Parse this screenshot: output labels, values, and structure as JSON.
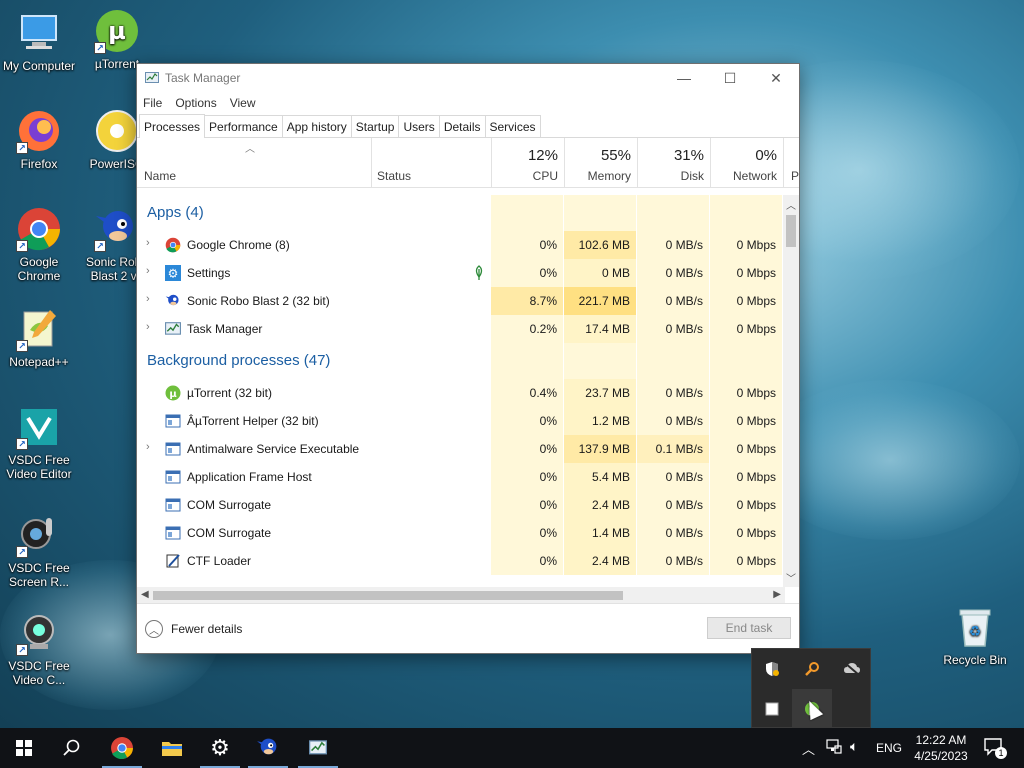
{
  "desktop": {
    "icons": [
      {
        "label": "My Computer",
        "icon": "computer-icon"
      },
      {
        "label": "µTorrent",
        "icon": "utorrent-icon"
      },
      {
        "label": "Firefox",
        "icon": "firefox-icon"
      },
      {
        "label": "PowerISO",
        "icon": "poweriso-icon"
      },
      {
        "label": "Google Chrome",
        "icon": "chrome-icon"
      },
      {
        "label": "Sonic Robo Blast 2 v2",
        "icon": "sonic-icon"
      },
      {
        "label": "Notepad++",
        "icon": "notepadpp-icon"
      },
      {
        "label": "VSDC Free Video Editor",
        "icon": "vsdc-editor-icon"
      },
      {
        "label": "VSDC Free Screen R...",
        "icon": "vsdc-screen-icon"
      },
      {
        "label": "VSDC Free Video C...",
        "icon": "vsdc-capture-icon"
      },
      {
        "label": "Recycle Bin",
        "icon": "recycle-bin-icon"
      }
    ]
  },
  "window": {
    "title": "Task Manager",
    "menu": [
      "File",
      "Options",
      "View"
    ],
    "tabs": [
      "Processes",
      "Performance",
      "App history",
      "Startup",
      "Users",
      "Details",
      "Services"
    ],
    "active_tab": "Processes",
    "columns": {
      "name": "Name",
      "status": "Status",
      "cpu": {
        "pct": "12%",
        "label": "CPU"
      },
      "memory": {
        "pct": "55%",
        "label": "Memory"
      },
      "disk": {
        "pct": "31%",
        "label": "Disk"
      },
      "network": {
        "pct": "0%",
        "label": "Network"
      },
      "power_partial": "P"
    },
    "groups": [
      {
        "title": "Apps (4)",
        "rows": [
          {
            "name": "Google Chrome (8)",
            "expandable": true,
            "icon": "chrome-icon",
            "status": "",
            "cpu": "0%",
            "memory": "102.6 MB",
            "disk": "0 MB/s",
            "network": "0 Mbps"
          },
          {
            "name": "Settings",
            "expandable": true,
            "icon": "gear-icon",
            "status": "leaf-icon",
            "cpu": "0%",
            "memory": "0 MB",
            "disk": "0 MB/s",
            "network": "0 Mbps"
          },
          {
            "name": "Sonic Robo Blast 2 (32 bit)",
            "expandable": true,
            "icon": "sonic-icon",
            "status": "",
            "cpu": "8.7%",
            "memory": "221.7 MB",
            "disk": "0 MB/s",
            "network": "0 Mbps"
          },
          {
            "name": "Task Manager",
            "expandable": true,
            "icon": "taskmanager-icon",
            "status": "",
            "cpu": "0.2%",
            "memory": "17.4 MB",
            "disk": "0 MB/s",
            "network": "0 Mbps"
          }
        ]
      },
      {
        "title": "Background processes (47)",
        "rows": [
          {
            "name": "µTorrent (32 bit)",
            "expandable": false,
            "icon": "utorrent-icon",
            "status": "",
            "cpu": "0.4%",
            "memory": "23.7 MB",
            "disk": "0 MB/s",
            "network": "0 Mbps"
          },
          {
            "name": "ÂµTorrent Helper (32 bit)",
            "expandable": false,
            "icon": "process-icon",
            "status": "",
            "cpu": "0%",
            "memory": "1.2 MB",
            "disk": "0 MB/s",
            "network": "0 Mbps"
          },
          {
            "name": "Antimalware Service Executable",
            "expandable": true,
            "icon": "process-icon",
            "status": "",
            "cpu": "0%",
            "memory": "137.9 MB",
            "disk": "0.1 MB/s",
            "network": "0 Mbps"
          },
          {
            "name": "Application Frame Host",
            "expandable": false,
            "icon": "process-icon",
            "status": "",
            "cpu": "0%",
            "memory": "5.4 MB",
            "disk": "0 MB/s",
            "network": "0 Mbps"
          },
          {
            "name": "COM Surrogate",
            "expandable": false,
            "icon": "process-icon",
            "status": "",
            "cpu": "0%",
            "memory": "2.4 MB",
            "disk": "0 MB/s",
            "network": "0 Mbps"
          },
          {
            "name": "COM Surrogate",
            "expandable": false,
            "icon": "process-icon",
            "status": "",
            "cpu": "0%",
            "memory": "1.4 MB",
            "disk": "0 MB/s",
            "network": "0 Mbps"
          },
          {
            "name": "CTF Loader",
            "expandable": false,
            "icon": "ctf-icon",
            "status": "",
            "cpu": "0%",
            "memory": "2.4 MB",
            "disk": "0 MB/s",
            "network": "0 Mbps"
          }
        ]
      }
    ],
    "footer": {
      "fewer_details": "Fewer details",
      "end_task": "End task"
    }
  },
  "taskbar": {
    "items": [
      "start-icon",
      "search-icon",
      "chrome-icon",
      "file-explorer-icon",
      "gear-icon",
      "sonic-icon",
      "taskmanager-icon"
    ],
    "language": "ENG",
    "time": "12:22 AM",
    "date": "4/25/2023",
    "notification_count": "1"
  },
  "colors": {
    "cpu_heat_low": "#fff8d9",
    "cpu_heat_mid": "#ffefb3",
    "mem_heat_high": "#ffe082",
    "link_blue": "#1c5fa3"
  }
}
